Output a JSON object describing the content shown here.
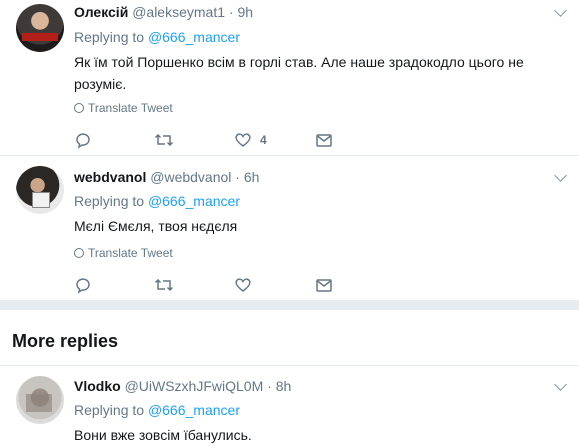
{
  "tweets": [
    {
      "name": "Олексій",
      "handle": "@alekseymat1",
      "dot": "·",
      "time": "9h",
      "replying_prefix": "Replying to ",
      "replying_to": "@666_mancer",
      "text": "Як їм той Порше­нко всім в горлі став. Але наше зрадокодло цього не розуміє.",
      "translate": "Translate Tweet",
      "like_count": "4"
    },
    {
      "name": "webdvanol",
      "handle": "@webdvanol",
      "dot": "·",
      "time": "6h",
      "replying_prefix": "Replying to ",
      "replying_to": "@666_mancer",
      "text": "Мєлі Ємєля, твоя нєдєля",
      "translate": "Translate Tweet",
      "like_count": ""
    },
    {
      "name": "Vlodko",
      "handle": "@UiWSzxhJFwiQL0M",
      "dot": "·",
      "time": "8h",
      "replying_prefix": "Replying to ",
      "replying_to": "@666_mancer",
      "text": "Вони вже зовсім їбанулись."
    }
  ],
  "more_replies": "More replies",
  "icons": {
    "reply": "reply-icon",
    "retweet": "retweet-icon",
    "like": "heart-icon",
    "dm": "envelope-icon",
    "translate": "globe-icon",
    "menu": "chevron-down-icon"
  },
  "colors": {
    "accent": "#1da1f2",
    "muted": "#657786",
    "divider": "#e6ecf0"
  }
}
